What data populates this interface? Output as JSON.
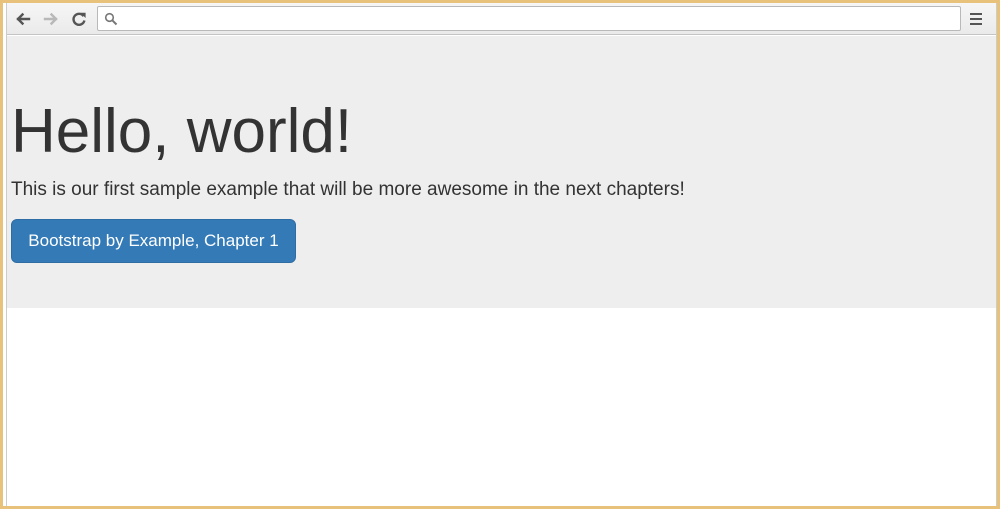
{
  "browser": {
    "address_bar": {
      "value": "",
      "placeholder": ""
    },
    "icons": {
      "back": "arrow-left-icon",
      "forward": "arrow-right-icon",
      "reload": "reload-icon",
      "search": "search-icon",
      "menu": "hamburger-menu-icon"
    },
    "colors": {
      "frame_border": "#e8c27a",
      "toolbar": "#eeeeee"
    }
  },
  "page": {
    "jumbotron": {
      "heading": "Hello, world!",
      "lead": "This is our first sample example that will be more awesome in the next chapters!",
      "button_label": "Bootstrap by Example, Chapter 1"
    },
    "colors": {
      "jumbotron_bg": "#eeeeee",
      "text": "#333333",
      "button_bg": "#337ab7",
      "button_text": "#ffffff"
    }
  }
}
